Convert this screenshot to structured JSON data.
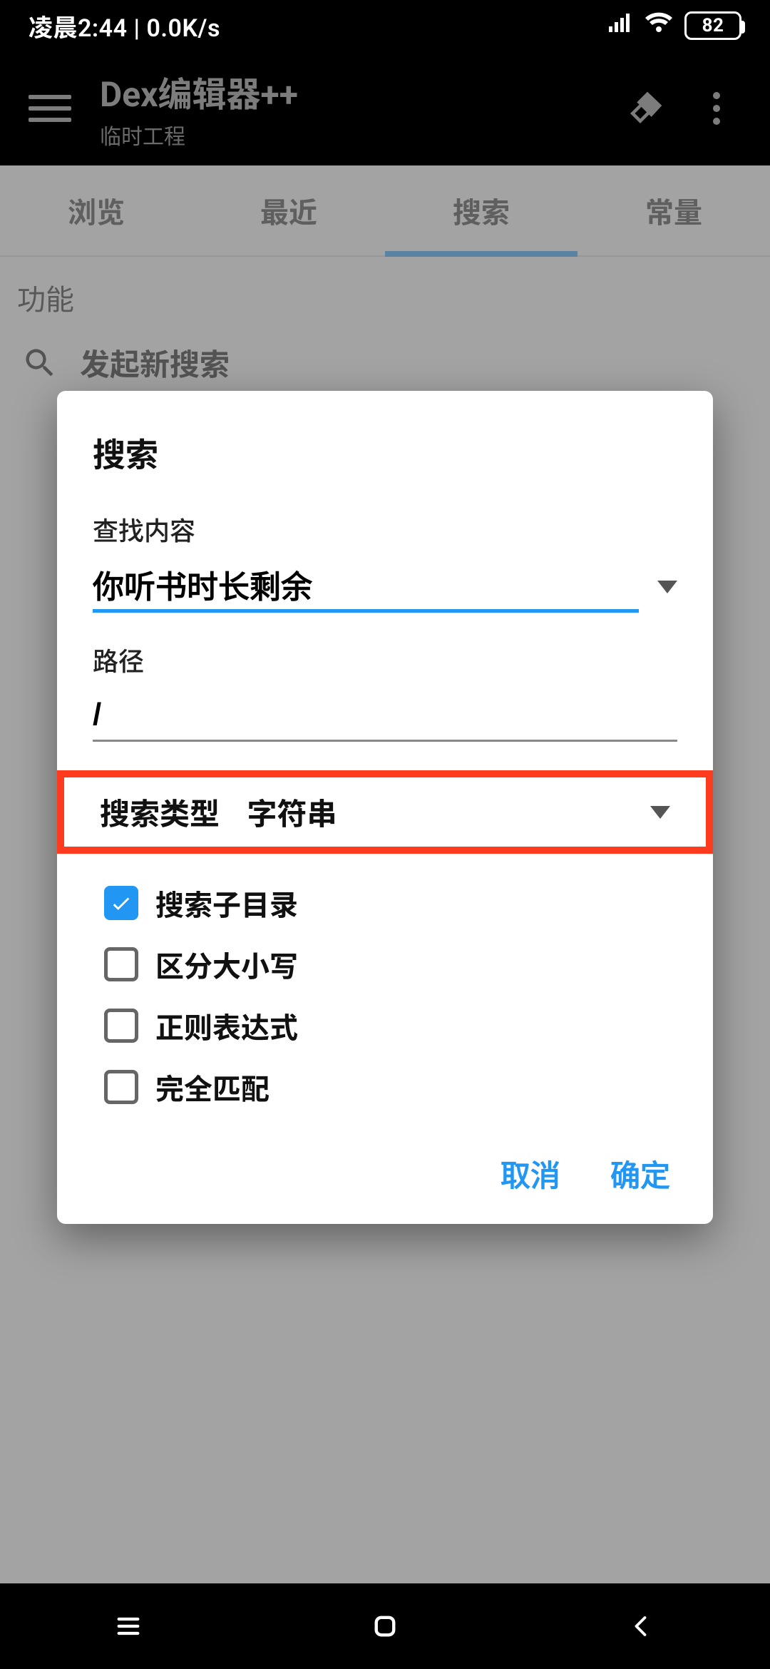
{
  "statusbar": {
    "time_text": "凌晨2:44 | 0.0K/s",
    "battery": "82"
  },
  "toolbar": {
    "title": "Dex编辑器++",
    "subtitle": "临时工程"
  },
  "tabs": {
    "browse": "浏览",
    "recent": "最近",
    "search": "搜索",
    "constants": "常量"
  },
  "page": {
    "section_title": "功能",
    "new_search_label": "发起新搜索"
  },
  "dialog": {
    "title": "搜索",
    "find_label": "查找内容",
    "find_value": "你听书时长剩余",
    "path_label": "路径",
    "path_value": "/",
    "type_label": "搜索类型",
    "type_value": "字符串",
    "checks": {
      "subdirs": "搜索子目录",
      "case": "区分大小写",
      "regex": "正则表达式",
      "exact": "完全匹配"
    },
    "cancel": "取消",
    "ok": "确定"
  }
}
